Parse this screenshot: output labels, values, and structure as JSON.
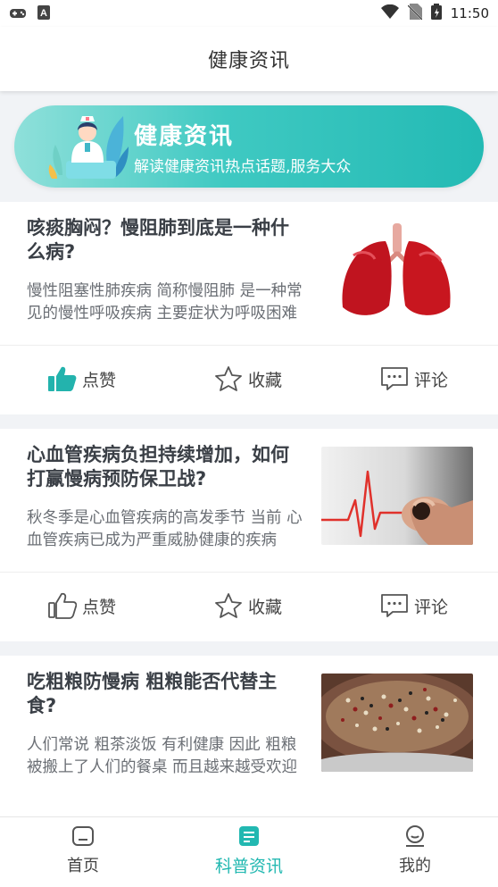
{
  "status_bar": {
    "time": "11:50"
  },
  "header": {
    "title": "健康资讯"
  },
  "banner": {
    "title": "健康资讯",
    "subtitle": "解读健康资讯热点话题,服务大众"
  },
  "articles": [
    {
      "title": "咳痰胸闷？慢阻肺到底是一种什么病?",
      "summary": "慢性阻塞性肺疾病 简称慢阻肺 是一种常见的慢性呼吸疾病 主要症状为呼吸困难",
      "thumbnail": "lungs-image",
      "liked": true
    },
    {
      "title": "心血管疾病负担持续增加，如何打赢慢病预防保卫战?",
      "summary": "秋冬季是心血管疾病的高发季节 当前 心血管疾病已成为严重威胁健康的疾病",
      "thumbnail": "heartbeat-image",
      "liked": false
    },
    {
      "title": "吃粗粮防慢病 粗粮能否代替主食?",
      "summary": "人们常说 粗茶淡饭 有利健康 因此 粗粮被搬上了人们的餐桌 而且越来越受欢迎",
      "thumbnail": "grains-image",
      "liked": false
    }
  ],
  "actions": {
    "like": "点赞",
    "favorite": "收藏",
    "comment": "评论"
  },
  "tabbar": {
    "home": "首页",
    "science": "科普资讯",
    "mine": "我的"
  },
  "colors": {
    "accent": "#22b8b1",
    "banner_start": "#8fe0da",
    "banner_end": "#23bab4"
  }
}
